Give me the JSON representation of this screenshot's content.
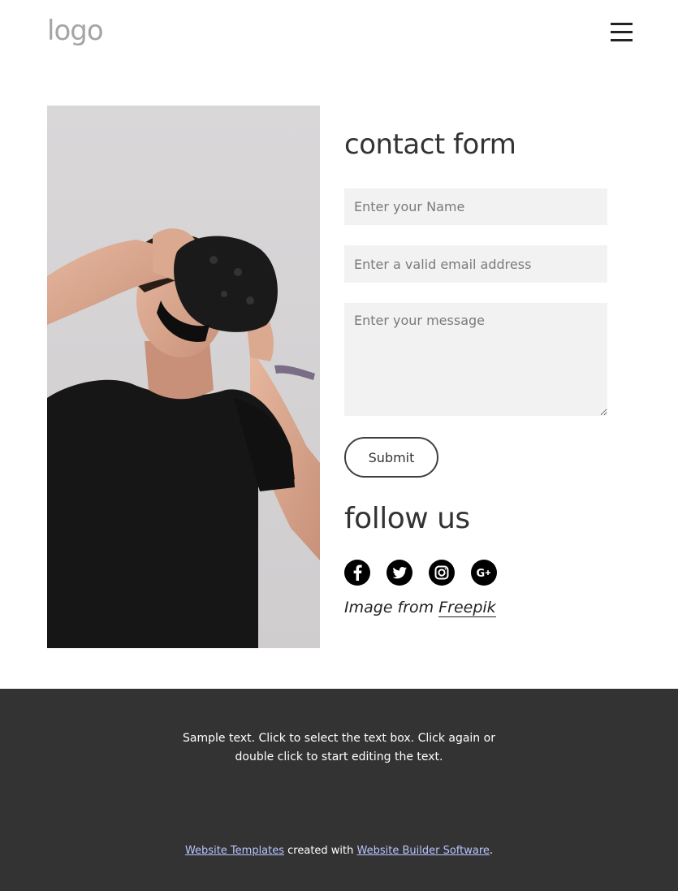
{
  "header": {
    "logo_text": "logo",
    "menu_icon": "hamburger-menu-icon"
  },
  "hero_image": {
    "subject": "man in black t-shirt wearing VR headset"
  },
  "contact": {
    "title": "contact form",
    "name_placeholder": "Enter your Name",
    "email_placeholder": "Enter a valid email address",
    "message_placeholder": "Enter your message",
    "submit_label": "Submit"
  },
  "follow": {
    "title": "follow us",
    "icons": [
      "facebook-icon",
      "twitter-icon",
      "instagram-icon",
      "google-plus-icon"
    ]
  },
  "credit": {
    "prefix": "Image from ",
    "link": "Freepik"
  },
  "footer": {
    "text": "Sample text. Click to select the text box. Click again or double click to start editing the text.",
    "link1": "Website Templates",
    "middle": " created with ",
    "link2": "Website Builder Software",
    "suffix": "."
  },
  "colors": {
    "footer_bg": "#333333",
    "input_bg": "#f2f2f2",
    "link_color": "#b9c4ff"
  }
}
